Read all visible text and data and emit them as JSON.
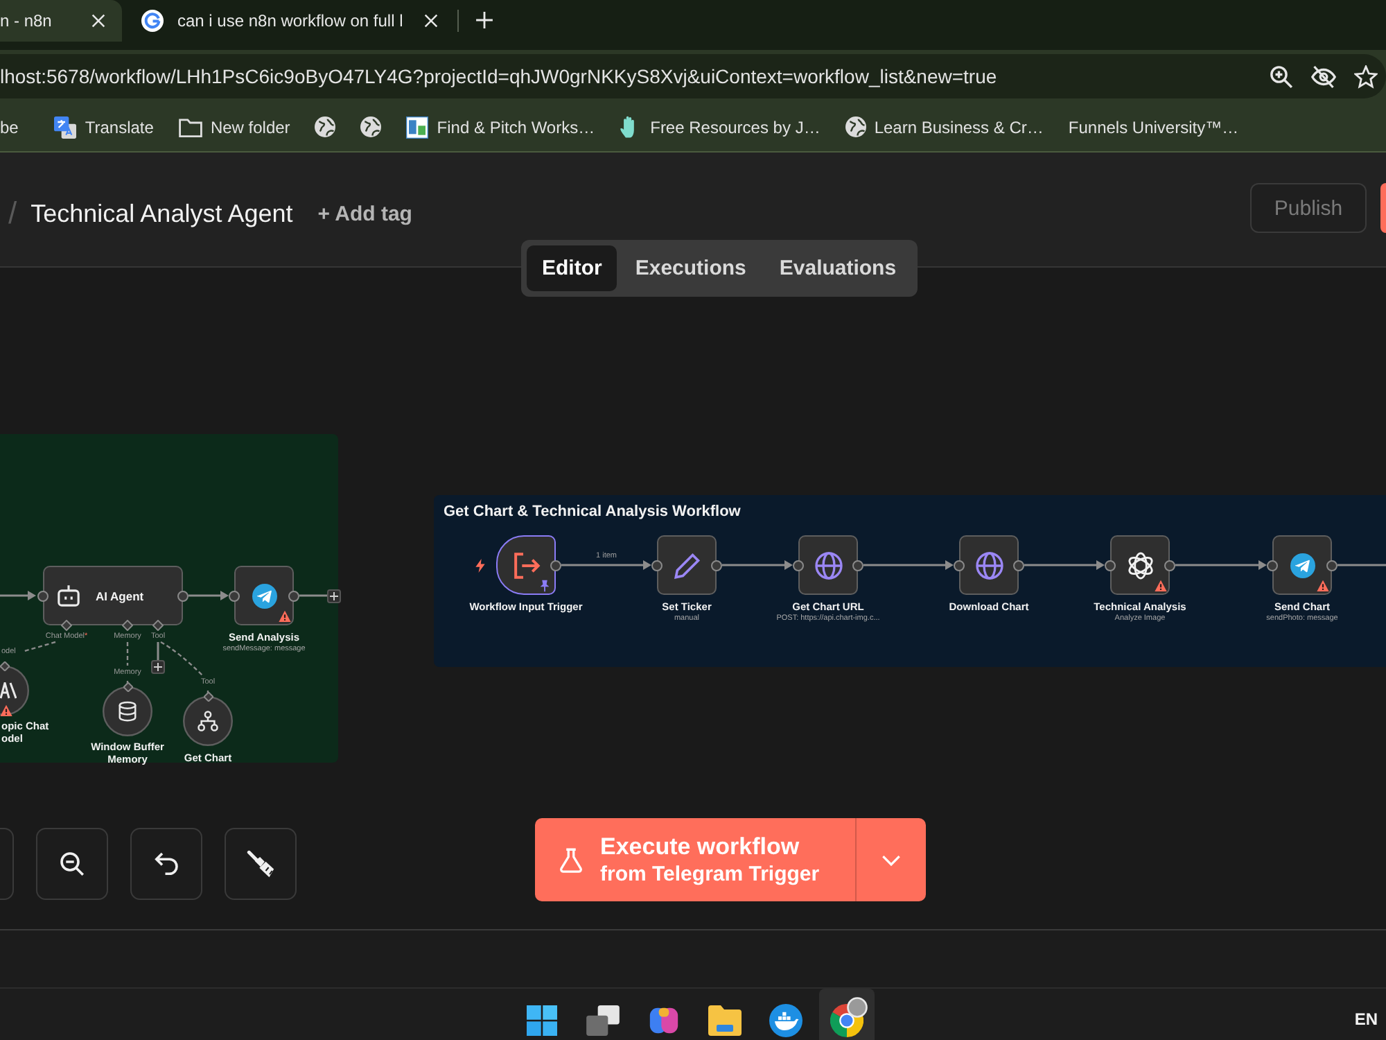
{
  "browser": {
    "tabs": [
      {
        "title": "n - n8n",
        "selected": true
      },
      {
        "title": "can i use n8n workflow on full l",
        "selected": false
      }
    ],
    "address": "lhost:5678/workflow/LHh1PsC6ic9oByO47LY4G?projectId=qhJW0grNKKyS8Xvj&uiContext=workflow_list&new=true",
    "bookmarks": [
      {
        "kind": "link",
        "label": "be"
      },
      {
        "kind": "link",
        "label": "Translate"
      },
      {
        "kind": "link",
        "label": "New folder"
      },
      {
        "kind": "icon"
      },
      {
        "kind": "icon"
      },
      {
        "kind": "link",
        "label": "Find & Pitch Works…"
      },
      {
        "kind": "link",
        "label": "Free Resources by J…"
      },
      {
        "kind": "link",
        "label": "Learn Business & Cr…"
      },
      {
        "kind": "link",
        "label": "Funnels University™…"
      }
    ]
  },
  "header": {
    "separator": "/",
    "title": "Technical Analyst Agent",
    "add_tag": "+ Add tag",
    "publish": {
      "label": "Publish",
      "disabled": true
    }
  },
  "view_tabs": [
    {
      "label": "Editor",
      "selected": true
    },
    {
      "label": "Executions",
      "selected": false
    },
    {
      "label": "Evaluations",
      "selected": false
    }
  ],
  "canvas": {
    "groups": [
      {
        "color": "#0c2a1a",
        "nodes": [
          {
            "kind": "agent",
            "label": "AI Agent",
            "warning": false,
            "pinned": false,
            "ports": [
              {
                "label": "Chat Model",
                "mark": "*"
              },
              {
                "label": "Memory"
              },
              {
                "label": "Tool"
              }
            ]
          },
          {
            "kind": "action",
            "label": "Send Analysis",
            "subtitle": "sendMessage: message",
            "warning": true,
            "pinned": false
          },
          {
            "kind": "sub",
            "label": "opic Chat\nodel",
            "port": "odel",
            "warning": true,
            "pinned": false
          },
          {
            "kind": "sub",
            "label": "Window Buffer Memory",
            "port": "Memory",
            "warning": false,
            "pinned": false
          },
          {
            "kind": "sub",
            "label": "Get Chart",
            "port": "Tool",
            "warning": false,
            "pinned": false
          }
        ]
      },
      {
        "color": "#0a1a2b",
        "title": "Get Chart & Technical Analysis Workflow",
        "nodes": [
          {
            "kind": "trigger",
            "label": "Workflow Input Trigger",
            "output_label": "1 item",
            "warning": false,
            "pinned": true
          },
          {
            "kind": "action",
            "label": "Set Ticker",
            "subtitle": "manual",
            "warning": false,
            "pinned": false
          },
          {
            "kind": "action",
            "label": "Get Chart URL",
            "subtitle": "POST: https://api.chart-img.c...",
            "warning": false,
            "pinned": false
          },
          {
            "kind": "action",
            "label": "Download Chart",
            "warning": false,
            "pinned": false
          },
          {
            "kind": "action",
            "label": "Technical Analysis",
            "subtitle": "Analyze Image",
            "warning": true,
            "pinned": false
          },
          {
            "kind": "action",
            "label": "Send Chart",
            "subtitle": "sendPhoto: message",
            "warning": true,
            "pinned": false
          }
        ]
      }
    ],
    "execute": {
      "title": "Execute workflow",
      "subtitle": "from Telegram Trigger"
    }
  },
  "taskbar": {
    "apps": [
      {
        "selected": false
      },
      {
        "selected": false
      },
      {
        "selected": false
      },
      {
        "selected": false
      },
      {
        "selected": false
      },
      {
        "selected": true
      }
    ],
    "language": "EN"
  }
}
